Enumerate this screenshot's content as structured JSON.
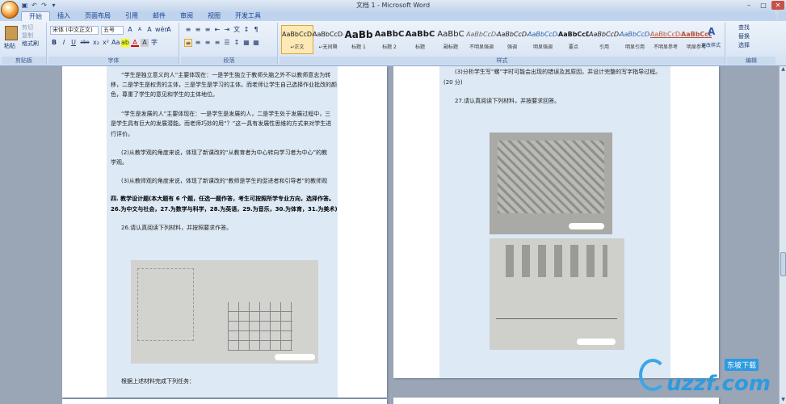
{
  "window": {
    "title": "文档 1 - Microsoft Word",
    "minimize": "–",
    "maximize": "□",
    "close": "✕"
  },
  "qat": {
    "save": "▣",
    "undo": "↶",
    "redo": "↷",
    "more": "▾"
  },
  "tabs": [
    "开始",
    "插入",
    "页面布局",
    "引用",
    "邮件",
    "审阅",
    "视图",
    "开发工具"
  ],
  "help": "❔",
  "ribbon": {
    "clipboard": {
      "label": "剪贴板",
      "paste": "粘贴",
      "cut": "剪切",
      "copy": "复制",
      "painter": "格式刷"
    },
    "font": {
      "label": "字体",
      "name": "宋体 (中文正文)",
      "size": "五号",
      "bold": "B",
      "italic": "I",
      "underline": "U",
      "strike": "abe",
      "sub": "x₂",
      "sup": "x²",
      "aa": "Aa",
      "grow": "A",
      "shrink": "A",
      "clear": "A",
      "wen": "wén",
      "border": "A",
      "highlight": "ab",
      "color": "A",
      "shade": "A",
      "enc": "字"
    },
    "paragraph": {
      "label": "段落",
      "row1": [
        "≡",
        "≡",
        "≡",
        "⇤",
        "⇥",
        "文",
        "↕",
        "¶"
      ],
      "row2": [
        "≡",
        "≡",
        "≡",
        "≡",
        "☰",
        "↕",
        "▦",
        "▦"
      ]
    },
    "styles": {
      "label": "样式",
      "items": [
        {
          "preview": "AaBbCcDd",
          "name": "↵正文"
        },
        {
          "preview": "AaBbCcDd",
          "name": "↵无间隔"
        },
        {
          "preview": "AaBb",
          "name": "标题 1"
        },
        {
          "preview": "AaBbC",
          "name": "标题 2"
        },
        {
          "preview": "AaBbC",
          "name": "标题"
        },
        {
          "preview": "AaBbC",
          "name": "副标题"
        },
        {
          "preview": "AaBbCcDd",
          "name": "不明显强调"
        },
        {
          "preview": "AaBbCcDd",
          "name": "强调"
        },
        {
          "preview": "AaBbCcDd",
          "name": "明显强调"
        },
        {
          "preview": "AaBbCcDd",
          "name": "要点"
        },
        {
          "preview": "AaBbCcDd",
          "name": "引用"
        },
        {
          "preview": "AaBbCcDd",
          "name": "明显引用"
        },
        {
          "preview": "AaBbCcDd",
          "name": "不明显参考"
        },
        {
          "preview": "AaBbCcDd",
          "name": "明显参考"
        }
      ],
      "change": "更改样式"
    },
    "editing": {
      "label": "编辑",
      "find": "查找",
      "replace": "替换",
      "select": "选择"
    }
  },
  "left_page": {
    "lines": [
      "“学生是独立意义的人”主要体现在：一是学生独立于教师头脑之外不以教师意志为转",
      "移，二是学生是权责的主体，三是学生是学习的主体。而老师让学生自己选择作业批改的颜",
      "色，尊重了学生的意见和学生的主体地位。",
      "“学生是发展的人”主要体现在：一是学生是发展的人，二是学生处于发展过程中，三",
      "是学生具有巨大的发展潜能。而老师巧妙的用“？”这一具有发展性思维的方式来对学生进",
      "行评价。",
      "(2)从教学观的角度来说，体现了新课改的“从教育者为中心转向学习者为中心”的教",
      "学观。",
      "(3)从教师观的角度来说，体现了新课改的“教师是学生的促进者和引导者”的教师观",
      "四. 教学设计题(本大题有 6 个题，任选一题作答，考生可按照所学专业方向，选择作答。",
      "26.为中文与社会，27.为数学与科学，28.为英语，29.为音乐，30.为体育，31.为美术)",
      "26.请认真阅读下列材料，并按照要求作答。",
      "根据上述材料完成下列任务："
    ]
  },
  "right_page": {
    "lines": [
      "(3)分析学生写“螺”字时可能会出现的错误及其原因，并设计完整的写字指导过程。",
      "(20 分)",
      "27.请认真阅读下列材料，并按要求回答。"
    ]
  },
  "watermark": {
    "brand": "uzzf.com",
    "cn": "东坡下载"
  }
}
